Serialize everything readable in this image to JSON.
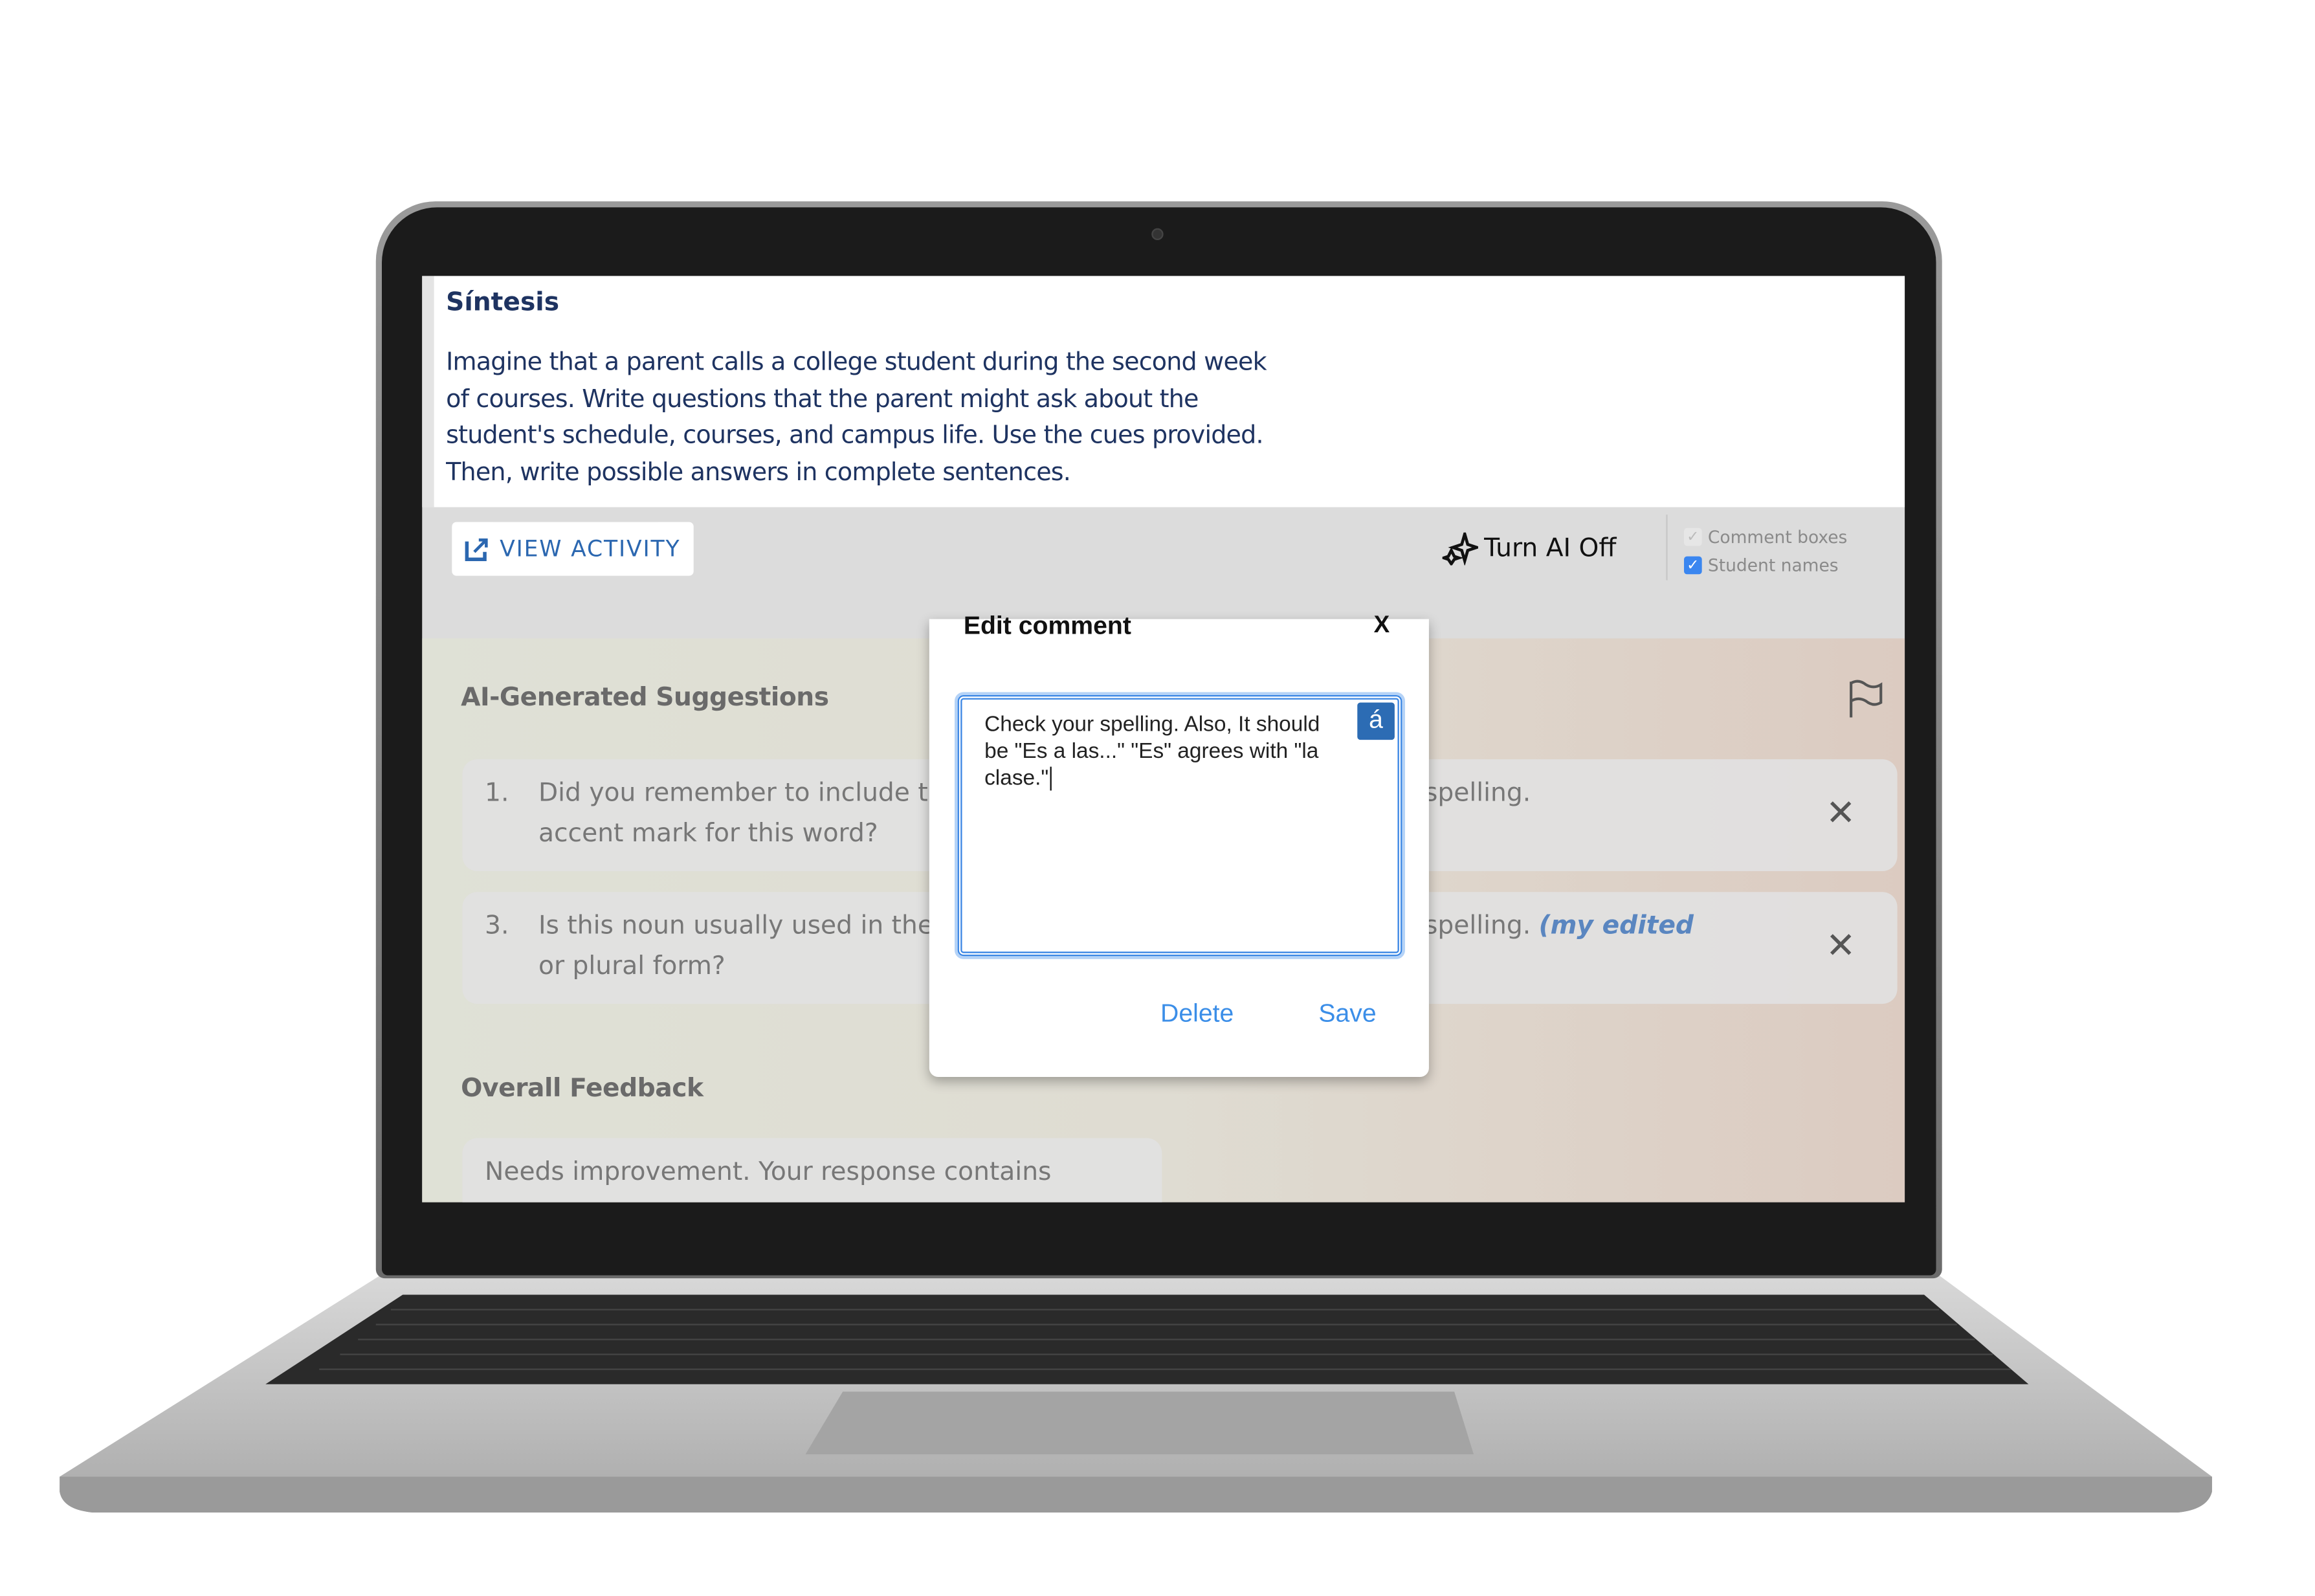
{
  "activity": {
    "title": "Síntesis",
    "prompt_lines": [
      "Imagine that a parent calls a college student during the second week",
      "of courses. Write questions that the parent might ask about the",
      "student's schedule, courses, and campus life. Use the cues provided.",
      "Then, write possible answers in complete sentences."
    ]
  },
  "toolbar": {
    "view_activity": "VIEW ACTIVITY",
    "ai_toggle": "Turn AI Off",
    "options": [
      {
        "label": "Comment boxes",
        "checked": true,
        "disabled": true
      },
      {
        "label": "Student names",
        "checked": true,
        "disabled": false
      }
    ]
  },
  "suggestions": {
    "heading": "AI-Generated Suggestions",
    "items": [
      {
        "number": "1.",
        "lines": [
          "Did you remember to include th",
          "accent mark for this word?"
        ],
        "comment": "spelling.",
        "note": ""
      },
      {
        "number": "3.",
        "lines": [
          "Is this noun usually used in the",
          "or plural form?"
        ],
        "comment": "spelling.",
        "note": "(my edited"
      }
    ]
  },
  "feedback": {
    "heading": "Overall Feedback",
    "text": "Needs improvement. Your response contains"
  },
  "dialog": {
    "title": "Edit comment",
    "close": "X",
    "text": "Check your spelling. Also, It should be \"Es a las...\" \"Es\" agrees with \"la clase.\"",
    "accent_button": "á",
    "delete": "Delete",
    "save": "Save"
  },
  "colors": {
    "accent": "#3b8ee8",
    "navy": "#1e3361",
    "link": "#2b67b0"
  }
}
